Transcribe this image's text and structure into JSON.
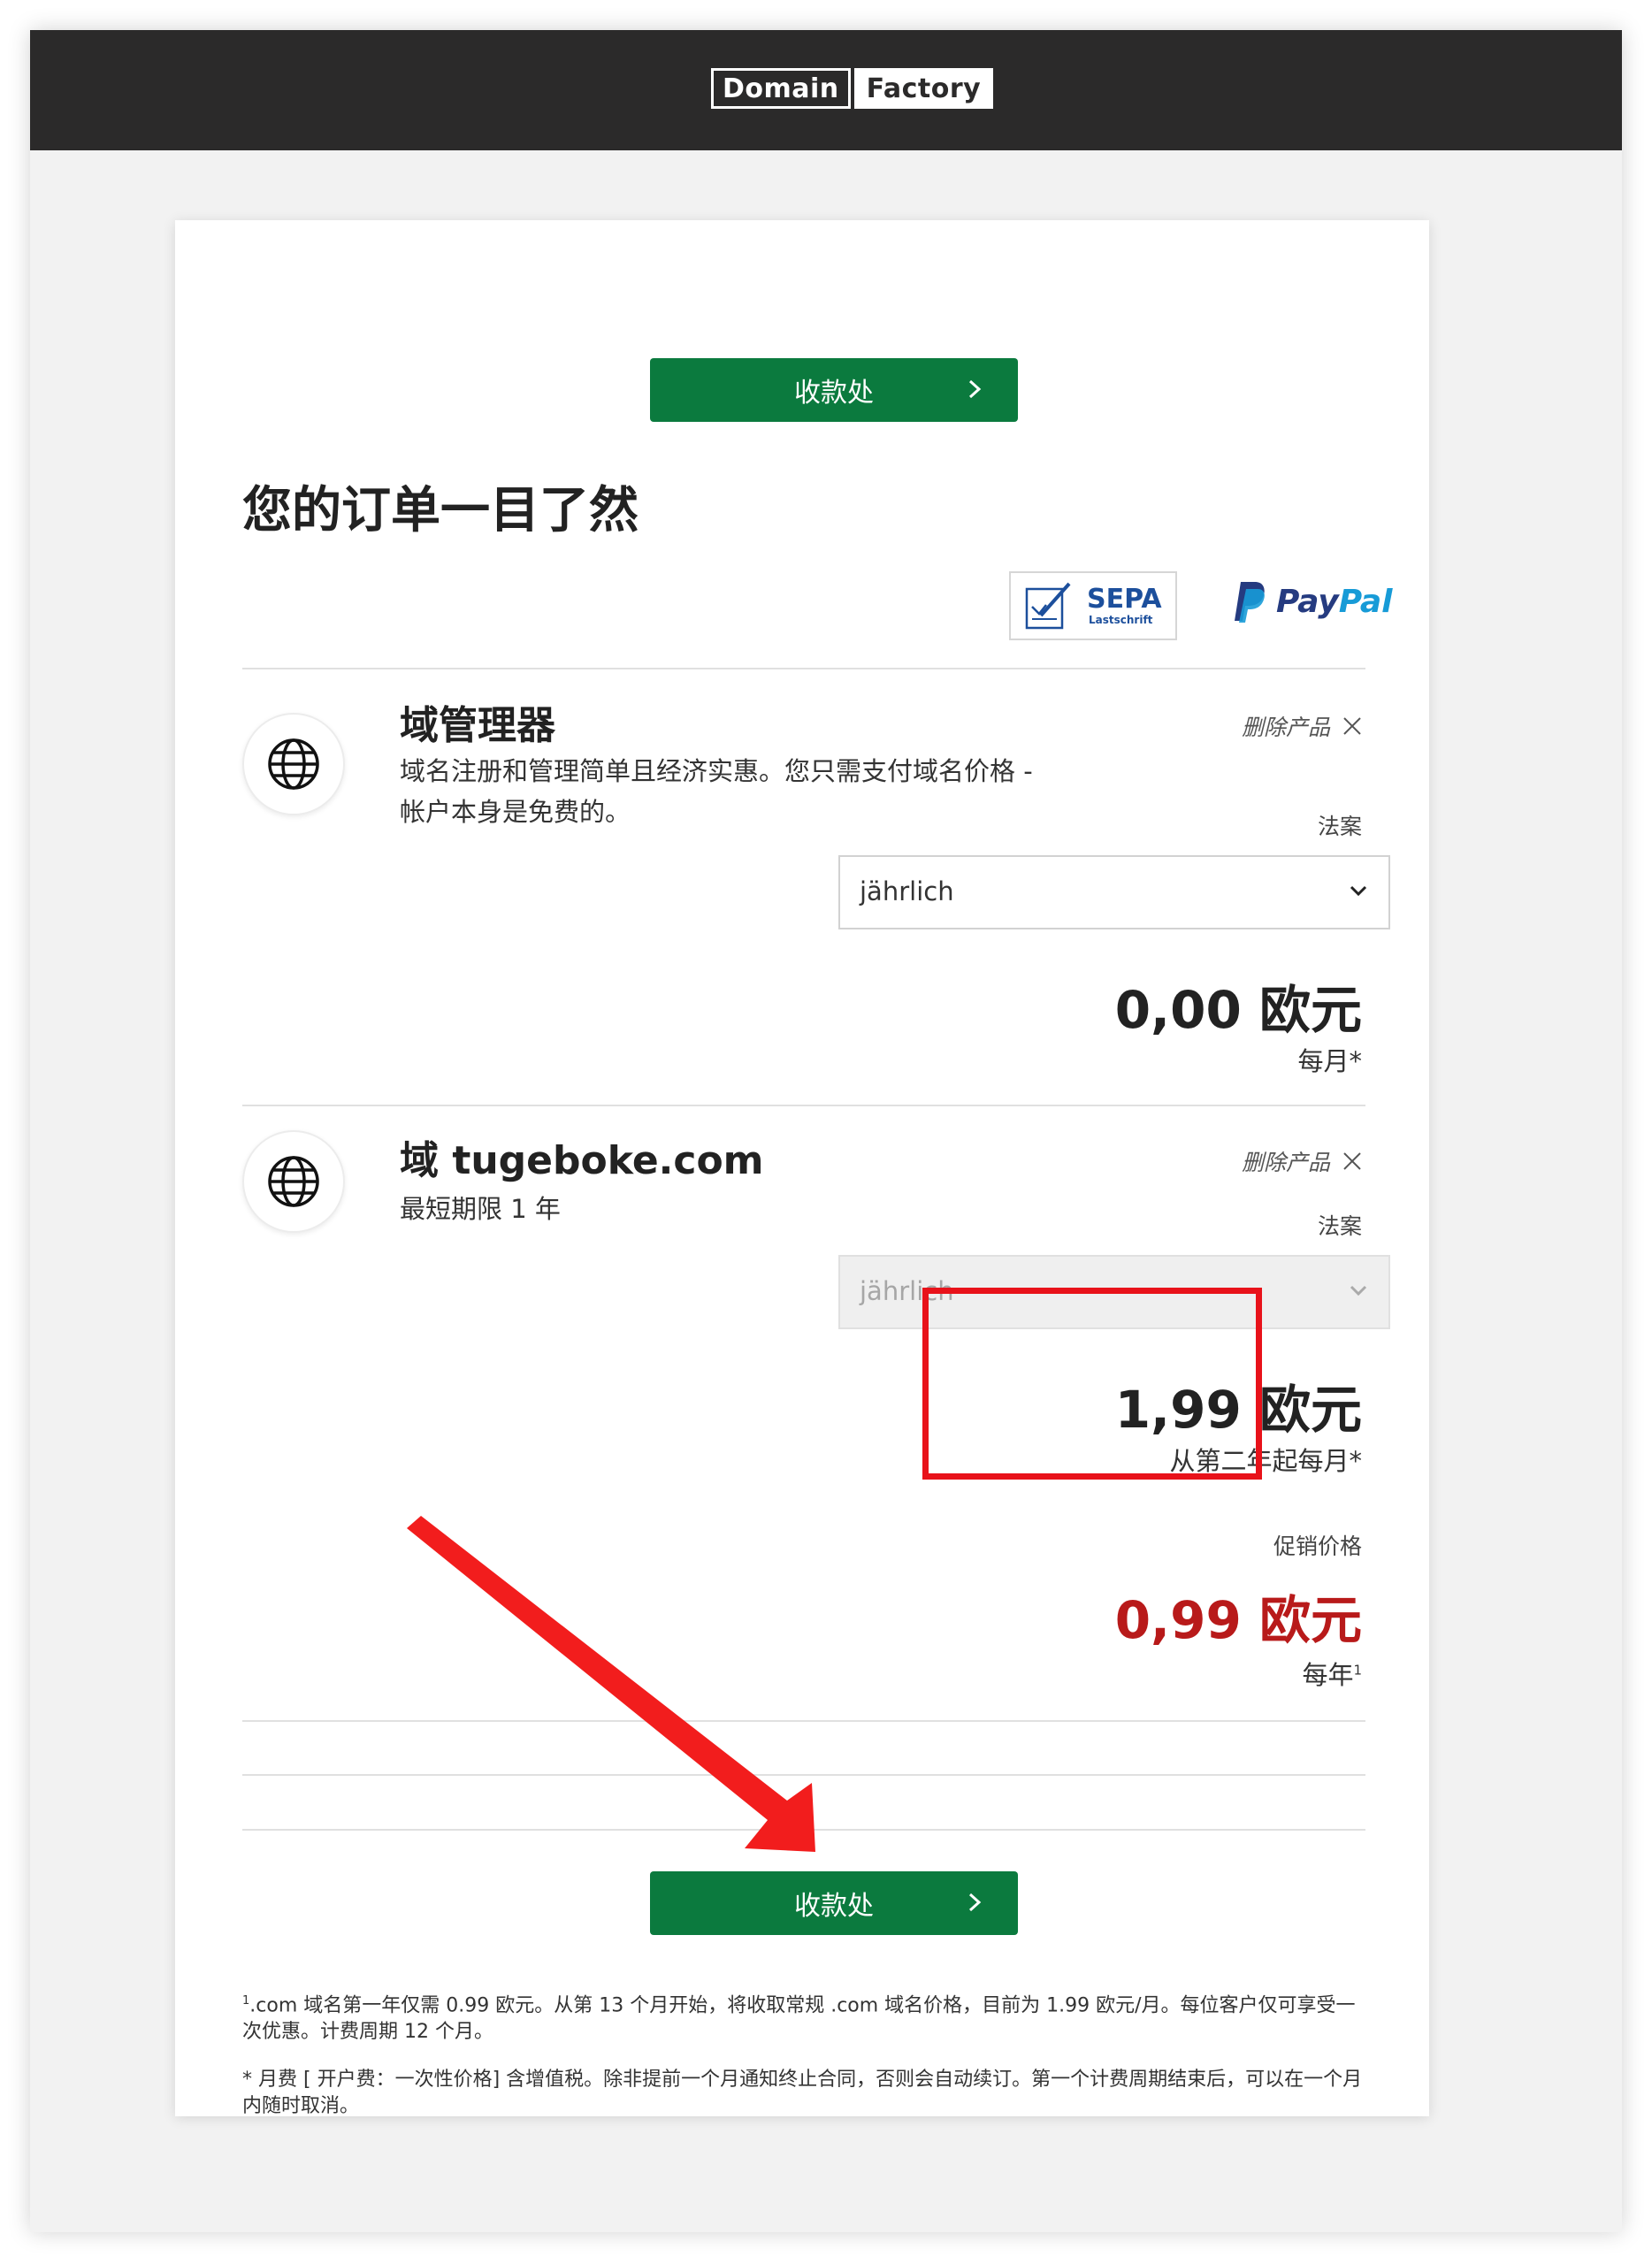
{
  "header": {
    "logo_part1": "Domain",
    "logo_part2": "Factory"
  },
  "checkout_button_label": "收款处",
  "page_title": "您的订单一目了然",
  "payment": {
    "sepa_label": "SEPA",
    "sepa_sub": "Lastschrift",
    "paypal_pay": "Pay",
    "paypal_pal": "Pal"
  },
  "products": [
    {
      "title": "域管理器",
      "description": "域名注册和管理简单且经济实惠。您只需支付域名价格 - 帐户本身是免费的。",
      "remove_label": "删除产品",
      "plan_label": "法案",
      "plan_value": "jährlich",
      "price": "0,00 欧元",
      "period": "每月*"
    },
    {
      "title": "域 tugeboke.com",
      "description": "最短期限 1 年",
      "remove_label": "删除产品",
      "plan_label": "法案",
      "plan_value": "jährlich",
      "price": "1,99 欧元",
      "period": "从第二年起每月*",
      "promo_label": "促销价格",
      "promo_price": "0,99 欧元",
      "promo_period": "每年",
      "promo_sup": "1"
    }
  ],
  "footnotes": {
    "note1_sup": "1",
    "note1": ".com 域名第一年仅需 0.99 欧元。从第 13 个月开始，将收取常规 .com 域名价格，目前为 1.99 欧元/月。每位客户仅可享受一次优惠。计费周期 12 个月。",
    "note2": "* 月费 [ 开户费：一次性价格] 含增值税。除非提前一个月通知终止合同，否则会自动续订。第一个计费周期结束后，可以在一个月内随时取消。"
  },
  "colors": {
    "green": "#0b7a3e",
    "promo_red": "#b81a1a",
    "highlight_red": "#e8121a",
    "header_bg": "#2b2a2a"
  }
}
